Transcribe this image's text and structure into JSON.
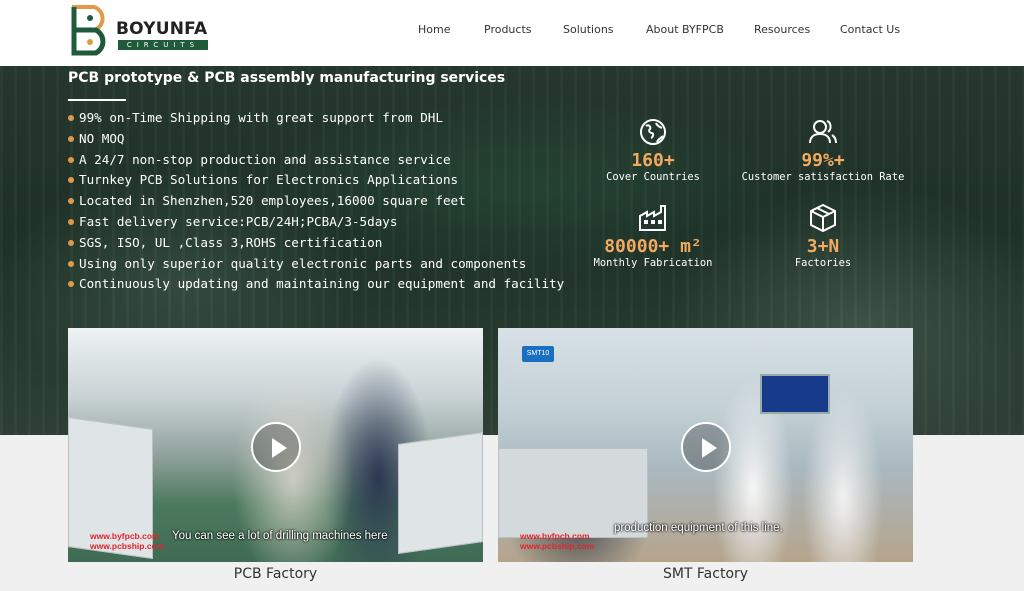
{
  "brand": {
    "name": "BOYUNFA",
    "tagline": "CIRCUITS",
    "colors": {
      "dark_green": "#1f5a3a",
      "orange": "#e29a4a"
    }
  },
  "nav": {
    "items": [
      {
        "label": "Home"
      },
      {
        "label": "Products"
      },
      {
        "label": "Solutions"
      },
      {
        "label": "About BYFPCB"
      },
      {
        "label": "Resources"
      },
      {
        "label": "Contact Us"
      }
    ]
  },
  "hero": {
    "title": "PCB prototype & PCB assembly manufacturing services",
    "features": [
      "99% on-Time Shipping with great support from DHL",
      "NO MOQ",
      "A 24/7 non-stop production and assistance service",
      "Turnkey PCB Solutions for Electronics Applications",
      "Located in Shenzhen,520 employees,16000 square feet",
      "Fast delivery service:PCB/24H;PCBA/3-5days",
      "SGS, ISO, UL ,Class 3,ROHS certification",
      "Using only superior quality electronic parts and components",
      "Continuously updating and maintaining our equipment and facility"
    ],
    "stats": [
      {
        "icon": "globe-icon",
        "value": "160+",
        "label": "Cover Countries"
      },
      {
        "icon": "users-icon",
        "value": "99%+",
        "label": "Customer satisfaction Rate"
      },
      {
        "icon": "factory-icon",
        "value": "80000+ m²",
        "label": "Monthly Fabrication"
      },
      {
        "icon": "box-icon",
        "value": "3+N",
        "label": "Factories"
      }
    ]
  },
  "videos": [
    {
      "title": "PCB Factory",
      "caption": "You can see a lot of drilling machines here",
      "watermark": [
        "www.byfpcb.com",
        "www.pcbship.com"
      ]
    },
    {
      "title": "SMT Factory",
      "caption": "production equipment of this line.",
      "watermark": [
        "www.byfpcb.com",
        "www.pcbship.com"
      ],
      "badge": "SMT10"
    }
  ]
}
